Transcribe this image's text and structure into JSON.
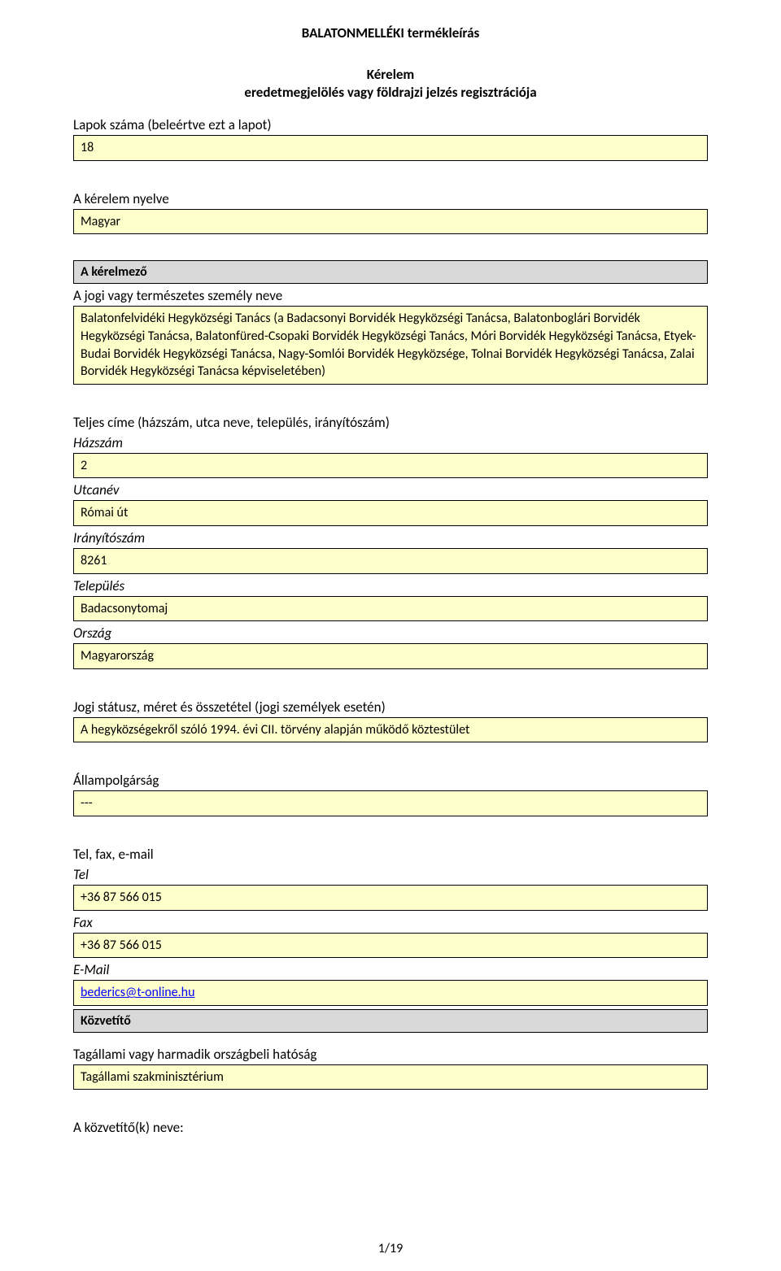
{
  "header": {
    "doc_title": "BALATONMELLÉKI termékleírás"
  },
  "title": {
    "line1": "Kérelem",
    "line2": "eredetmegjelölés vagy földrajzi jelzés regisztrációja"
  },
  "pages": {
    "label": "Lapok száma (beleértve ezt a lapot)",
    "value": "18"
  },
  "language": {
    "label": "A kérelem nyelve",
    "value": "Magyar"
  },
  "applicant": {
    "header": "A kérelmező",
    "name_label": "A jogi vagy természetes személy neve",
    "name_value": "Balatonfelvidéki Hegyközségi Tanács (a Badacsonyi Borvidék Hegyközségi Tanácsa, Balatonboglári Borvidék Hegyközségi Tanácsa, Balatonfüred-Csopaki Borvidék Hegyközségi Tanács, Móri Borvidék Hegyközségi Tanácsa, Etyek-Budai Borvidék Hegyközségi Tanácsa, Nagy-Somlói Borvidék Hegyközsége, Tolnai Borvidék Hegyközségi Tanácsa, Zalai Borvidék Hegyközségi Tanácsa képviseletében)"
  },
  "address": {
    "heading": "Teljes címe (házszám, utca neve, település, irányítószám)",
    "house_label": "Házszám",
    "house_value": "2",
    "street_label": "Utcanév",
    "street_value": "Római út",
    "postal_label": "Irányítószám",
    "postal_value": "8261",
    "town_label": "Település",
    "town_value": "Badacsonytomaj",
    "country_label": "Ország",
    "country_value": "Magyarország"
  },
  "legal_status": {
    "label": "Jogi státusz, méret és összetétel (jogi személyek esetén)",
    "value": "A hegyközségekről szóló 1994. évi CII. törvény alapján működő köztestület"
  },
  "citizenship": {
    "label": "Állampolgárság",
    "value": "---"
  },
  "contact": {
    "heading": "Tel, fax, e-mail",
    "tel_label": "Tel",
    "tel_value": "+36 87 566 015",
    "fax_label": "Fax",
    "fax_value": "+36 87 566 015",
    "email_label": "E-Mail",
    "email_value": "bederics@t-online.hu"
  },
  "intermediary": {
    "header": "Közvetítő",
    "authority_label": "Tagállami vagy harmadik országbeli hatóság",
    "authority_value": "Tagállami szakminisztérium",
    "name_label": "A közvetítő(k) neve:"
  },
  "footer": {
    "page_num": "1/19"
  }
}
